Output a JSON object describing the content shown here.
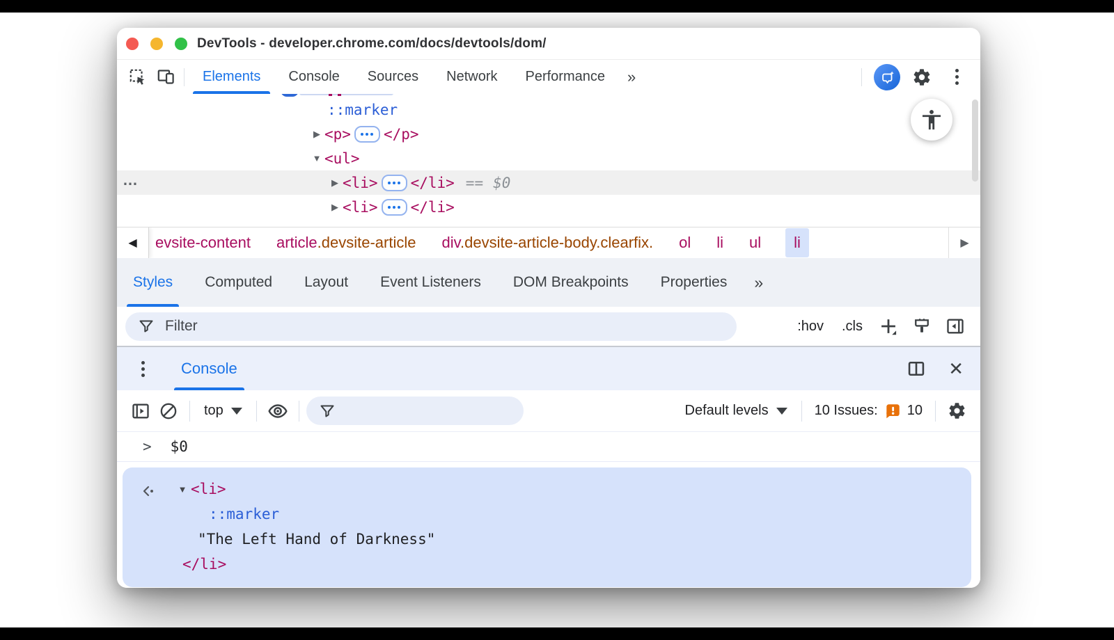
{
  "window": {
    "title": "DevTools - developer.chrome.com/docs/devtools/dom/"
  },
  "colors": {
    "accent_blue": "#1a73e8",
    "tag": "#a80d5f",
    "pseudo": "#2b5ed6",
    "class_attr": "#994500",
    "selection_bg": "#d6e2fb",
    "selected_row_bg": "#f0f0f0",
    "issue_orange": "#e8710a"
  },
  "toolbar": {
    "tabs": [
      {
        "label": "Elements"
      },
      {
        "label": "Console"
      },
      {
        "label": "Sources"
      },
      {
        "label": "Network"
      },
      {
        "label": "Performance"
      }
    ],
    "more": "»"
  },
  "elements": {
    "gutter_more": "…",
    "arrow_collapsed": "▶",
    "arrow_expanded": "▼",
    "rows": {
      "marker": {
        "text": "::marker"
      },
      "p": {
        "open": "<p>",
        "close": "</p>"
      },
      "ul": {
        "open": "<ul>"
      },
      "li_selected": {
        "open": "<li>",
        "close": "</li>",
        "eq": "==",
        "ref": "$0"
      },
      "li": {
        "open": "<li>",
        "close": "</li>"
      }
    }
  },
  "breadcrumb": {
    "prev": "◀",
    "next": "▶",
    "items": [
      {
        "tag": "evsite-content",
        "cls": ""
      },
      {
        "tag": "article",
        "cls": ".devsite-article"
      },
      {
        "tag": "div",
        "cls": ".devsite-article-body.clearfix."
      },
      {
        "tag": "ol",
        "cls": ""
      },
      {
        "tag": "li",
        "cls": ""
      },
      {
        "tag": "ul",
        "cls": ""
      },
      {
        "tag": "li",
        "cls": ""
      }
    ]
  },
  "styles_panel": {
    "tabs": [
      {
        "label": "Styles"
      },
      {
        "label": "Computed"
      },
      {
        "label": "Layout"
      },
      {
        "label": "Event Listeners"
      },
      {
        "label": "DOM Breakpoints"
      },
      {
        "label": "Properties"
      }
    ],
    "more": "»",
    "filter_placeholder": "Filter",
    "pseudo_toggle": ":hov",
    "class_toggle": ".cls"
  },
  "console": {
    "tab": "Console",
    "context_selector": "top",
    "levels_selector": "Default levels",
    "issues_label": "10 Issues:",
    "issues_count": "10",
    "prompt_chevron": ">",
    "prompt_value": "$0",
    "result": {
      "arrow": "▼",
      "open": "<li>",
      "marker": "::marker",
      "string": "\"The Left Hand of Darkness\"",
      "close": "</li>"
    }
  }
}
